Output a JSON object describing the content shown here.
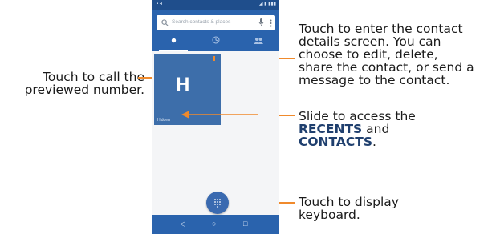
{
  "callouts": {
    "call": [
      "Touch to call the",
      "previewed number."
    ],
    "details": [
      "Touch to enter the contact",
      "details screen. You can",
      "choose to edit, delete,",
      "share the contact, or send a",
      "message to the contact."
    ],
    "slide_pre": "Slide to access the",
    "slide_recents": "RECENTS",
    "slide_and": " and",
    "slide_contacts": "CONTACTS",
    "slide_end": ".",
    "keyboard": [
      "Touch to display",
      "keyboard."
    ]
  },
  "phone": {
    "search_placeholder": "Search contacts & places",
    "card_letter": "H",
    "card_caption": "Hidden",
    "icons": [
      "search-icon",
      "mic-icon",
      "star-tab-icon",
      "clock-tab-icon",
      "people-tab-icon",
      "dialpad-icon",
      "back-icon",
      "home-icon",
      "recents-icon"
    ]
  },
  "colors": {
    "accent_line": "#f08a2c",
    "app_blue": "#2a63ad",
    "card_blue": "#3d6eaa",
    "heading_blue": "#1f3f6e"
  }
}
